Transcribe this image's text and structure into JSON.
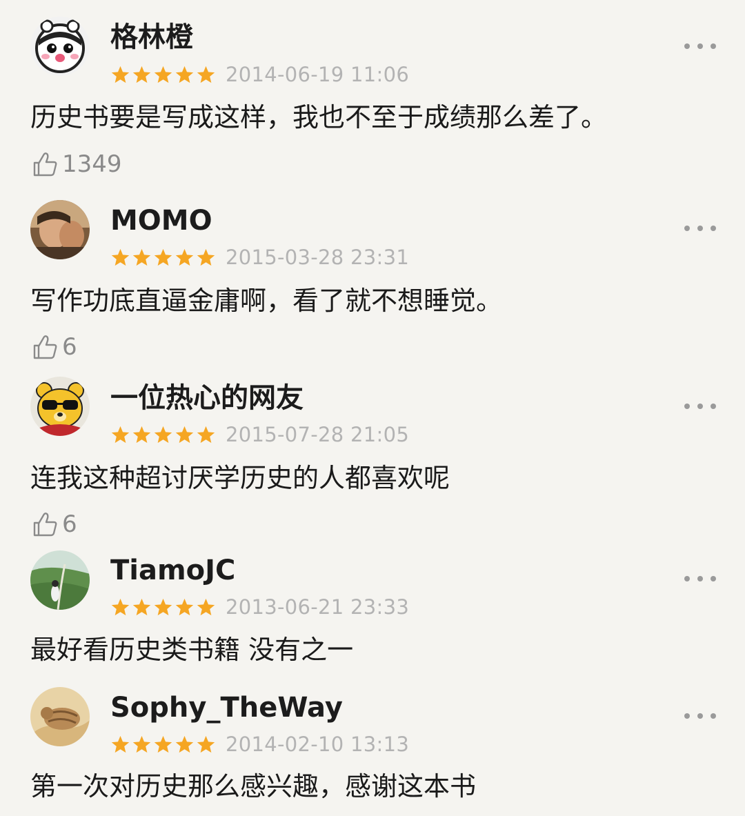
{
  "colors": {
    "star": "#f5a623",
    "date": "#b3b3b3",
    "like_count": "#8a8a8a",
    "background": "#f5f4f0"
  },
  "comments": [
    {
      "username": "格林橙",
      "rating": 5,
      "date": "2014-06-19 11:06",
      "text": "历史书要是写成这样，我也不至于成绩那么差了。",
      "likes": "1349",
      "avatar_icon": "cartoon-face-avatar"
    },
    {
      "username": "MOMO",
      "rating": 5,
      "date": "2015-03-28 23:31",
      "text": "写作功底直逼金庸啊，看了就不想睡觉。",
      "likes": "6",
      "avatar_icon": "photo-avatar"
    },
    {
      "username": "一位热心的网友",
      "rating": 5,
      "date": "2015-07-28 21:05",
      "text": "连我这种超讨厌学历史的人都喜欢呢",
      "likes": "6",
      "avatar_icon": "cartoon-bear-sunglasses-avatar"
    },
    {
      "username": "TiamoJC",
      "rating": 5,
      "date": "2013-06-21 23:33",
      "text": "最好看历史类书籍 没有之一",
      "avatar_icon": "landscape-photo-avatar"
    },
    {
      "username": "Sophy_TheWay",
      "rating": 5,
      "date": "2014-02-10 13:13",
      "text": "第一次对历史那么感兴趣，感谢这本书",
      "avatar_icon": "cat-photo-avatar"
    }
  ]
}
